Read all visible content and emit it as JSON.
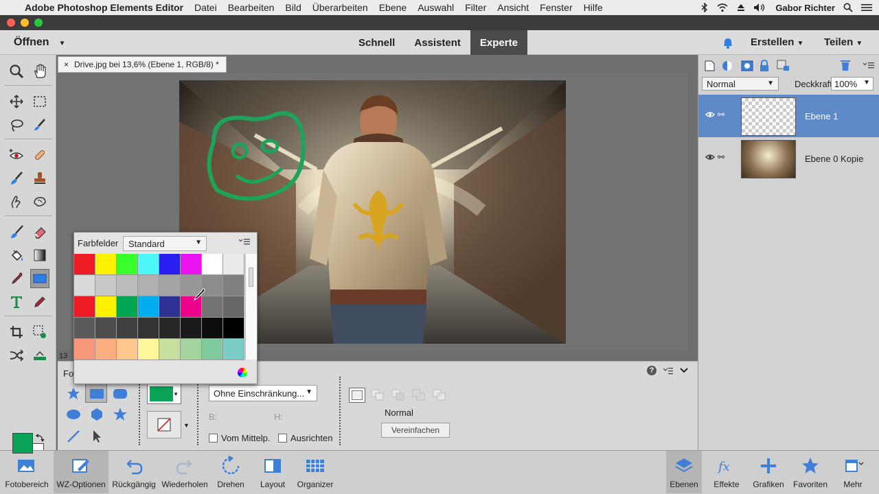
{
  "menubar": {
    "app_name": "Adobe Photoshop Elements Editor",
    "items": [
      "Datei",
      "Bearbeiten",
      "Bild",
      "Überarbeiten",
      "Ebene",
      "Auswahl",
      "Filter",
      "Ansicht",
      "Fenster",
      "Hilfe"
    ],
    "user": "Gabor Richter"
  },
  "modebar": {
    "open_label": "Öffnen",
    "tabs": [
      "Schnell",
      "Assistent",
      "Experte"
    ],
    "active_tab": "Experte",
    "create_label": "Erstellen",
    "share_label": "Teilen"
  },
  "document": {
    "tab_title": "Drive.jpg bei 13,6% (Ebene 1, RGB/8) *",
    "zoom_stub": "13"
  },
  "swatch_panel": {
    "title": "Farbfelder",
    "preset": "Standard",
    "colors": [
      "#ee1c24",
      "#fff200",
      "#39ff2d",
      "#4df7f7",
      "#2a1ff0",
      "#ea14f2",
      "#ffffff",
      "#ebebeb",
      "#d9d9d9",
      "#c8c8c8",
      "#bcbcbc",
      "#b0b0b0",
      "#a4a4a4",
      "#989898",
      "#8c8c8c",
      "#808080",
      "#ed1c24",
      "#fff200",
      "#00a651",
      "#00aeef",
      "#2e3192",
      "#ec008c",
      "#737373",
      "#666666",
      "#5a5a5a",
      "#4d4d4d",
      "#404040",
      "#333333",
      "#262626",
      "#1a1a1a",
      "#0d0d0d",
      "#000000",
      "#f7977a",
      "#fbad82",
      "#fdc68c",
      "#fff799",
      "#c6df9c",
      "#a4d49d",
      "#81ca9d",
      "#7bcdc9"
    ]
  },
  "options": {
    "panel_label_stub": "Fo",
    "constraint": "Ohne Einschränkung...",
    "b_label": "B:",
    "h_label": "H:",
    "from_center": "Vom Mittelp.",
    "align": "Ausrichten",
    "mode": "Normal",
    "simplify": "Vereinfachen",
    "help": "?",
    "color": "#0aa358"
  },
  "layers": {
    "blend_mode": "Normal",
    "opacity_label": "Deckkraft:",
    "opacity_value": "100%",
    "items": [
      {
        "name": "Ebene 1",
        "selected": true
      },
      {
        "name": "Ebene 0 Kopie",
        "selected": false
      }
    ]
  },
  "taskbar": {
    "left": [
      "Fotobereich",
      "WZ-Optionen",
      "Rückgängig",
      "Wiederholen",
      "Drehen",
      "Layout",
      "Organizer"
    ],
    "right": [
      "Ebenen",
      "Effekte",
      "Grafiken",
      "Favoriten",
      "Mehr"
    ]
  },
  "colors": {
    "foreground": "#0aa358",
    "background": "#ffffff",
    "accent": "#5f8ac7"
  }
}
